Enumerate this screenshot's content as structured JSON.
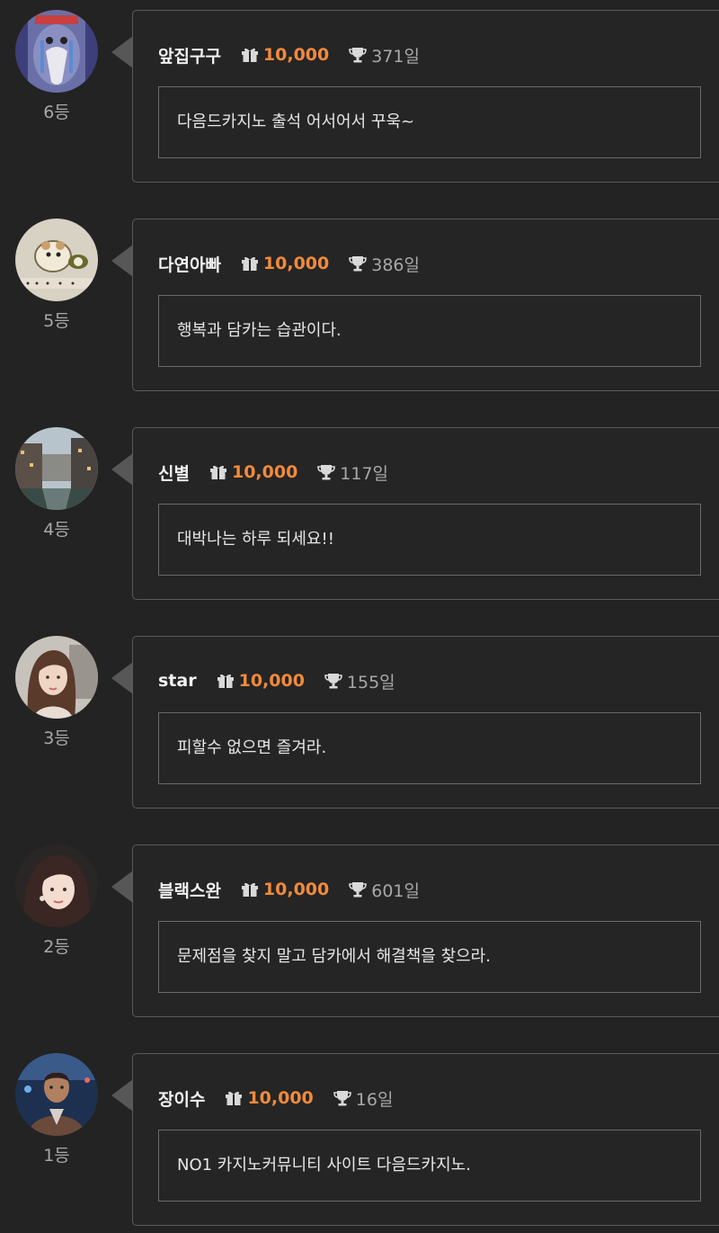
{
  "entries": [
    {
      "name": "앞집구구",
      "points": "10,000",
      "days": "371일",
      "message": "다음드카지노 출석 어서어서 꾸욱~",
      "rank": "6등",
      "avatar": "penguin-avatar"
    },
    {
      "name": "다연아빠",
      "points": "10,000",
      "days": "386일",
      "message": "행복과 담카는 습관이다.",
      "rank": "5등",
      "avatar": "hamster-avatar"
    },
    {
      "name": "신별",
      "points": "10,000",
      "days": "117일",
      "message": "대박나는 하루 되세요!!",
      "rank": "4등",
      "avatar": "canal-city-avatar"
    },
    {
      "name": "star",
      "points": "10,000",
      "days": "155일",
      "message": "피할수 없으면 즐겨라.",
      "rank": "3등",
      "avatar": "woman-portrait-avatar"
    },
    {
      "name": "블랙스완",
      "points": "10,000",
      "days": "601일",
      "message": "문제점을 찾지 말고 담카에서 해결책을 찾으라.",
      "rank": "2등",
      "avatar": "woman-portrait-avatar"
    },
    {
      "name": "장이수",
      "points": "10,000",
      "days": "16일",
      "message": "NO1 카지노커뮤니티 사이트 다음드카지노.",
      "rank": "1등",
      "avatar": "man-portrait-avatar"
    }
  ],
  "icons": {
    "points": "gift-icon",
    "days": "trophy-icon"
  },
  "colors": {
    "background": "#232323",
    "points": "#f28a3c",
    "name": "#f2f2f2",
    "muted": "#a8a8a8",
    "border": "#5a5a5a"
  }
}
